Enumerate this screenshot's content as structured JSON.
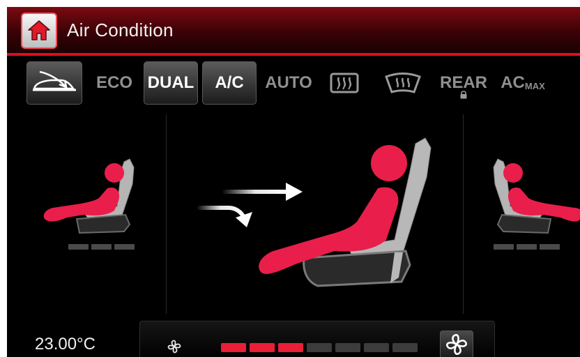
{
  "header": {
    "title": "Air Condition",
    "home_icon": "home-icon"
  },
  "toolbar": {
    "items": [
      {
        "id": "car-recirculation",
        "icon": "car-recirculation-icon",
        "active": true
      },
      {
        "id": "eco",
        "label": "ECO",
        "active": false
      },
      {
        "id": "dual",
        "label": "DUAL",
        "active": true
      },
      {
        "id": "ac",
        "label": "A/C",
        "active": true
      },
      {
        "id": "auto",
        "label": "AUTO",
        "active": false
      },
      {
        "id": "rear-defrost",
        "icon": "rear-defrost-icon",
        "active": false
      },
      {
        "id": "front-defrost",
        "icon": "front-defrost-icon",
        "active": false
      },
      {
        "id": "rear",
        "label": "REAR",
        "active": false
      },
      {
        "id": "acmax",
        "label": "AC",
        "sub": "MAX",
        "active": false
      }
    ]
  },
  "zones": {
    "left_seat_level": 3,
    "right_seat_level": 3,
    "airflow_mode": "face-and-body"
  },
  "bottom": {
    "temperature": "23.00°C",
    "fan_level": 3,
    "fan_max": 7
  },
  "colors": {
    "accent": "#e91e37",
    "title_bar": "#4a050a",
    "inactive_text": "#8f8f8f"
  }
}
